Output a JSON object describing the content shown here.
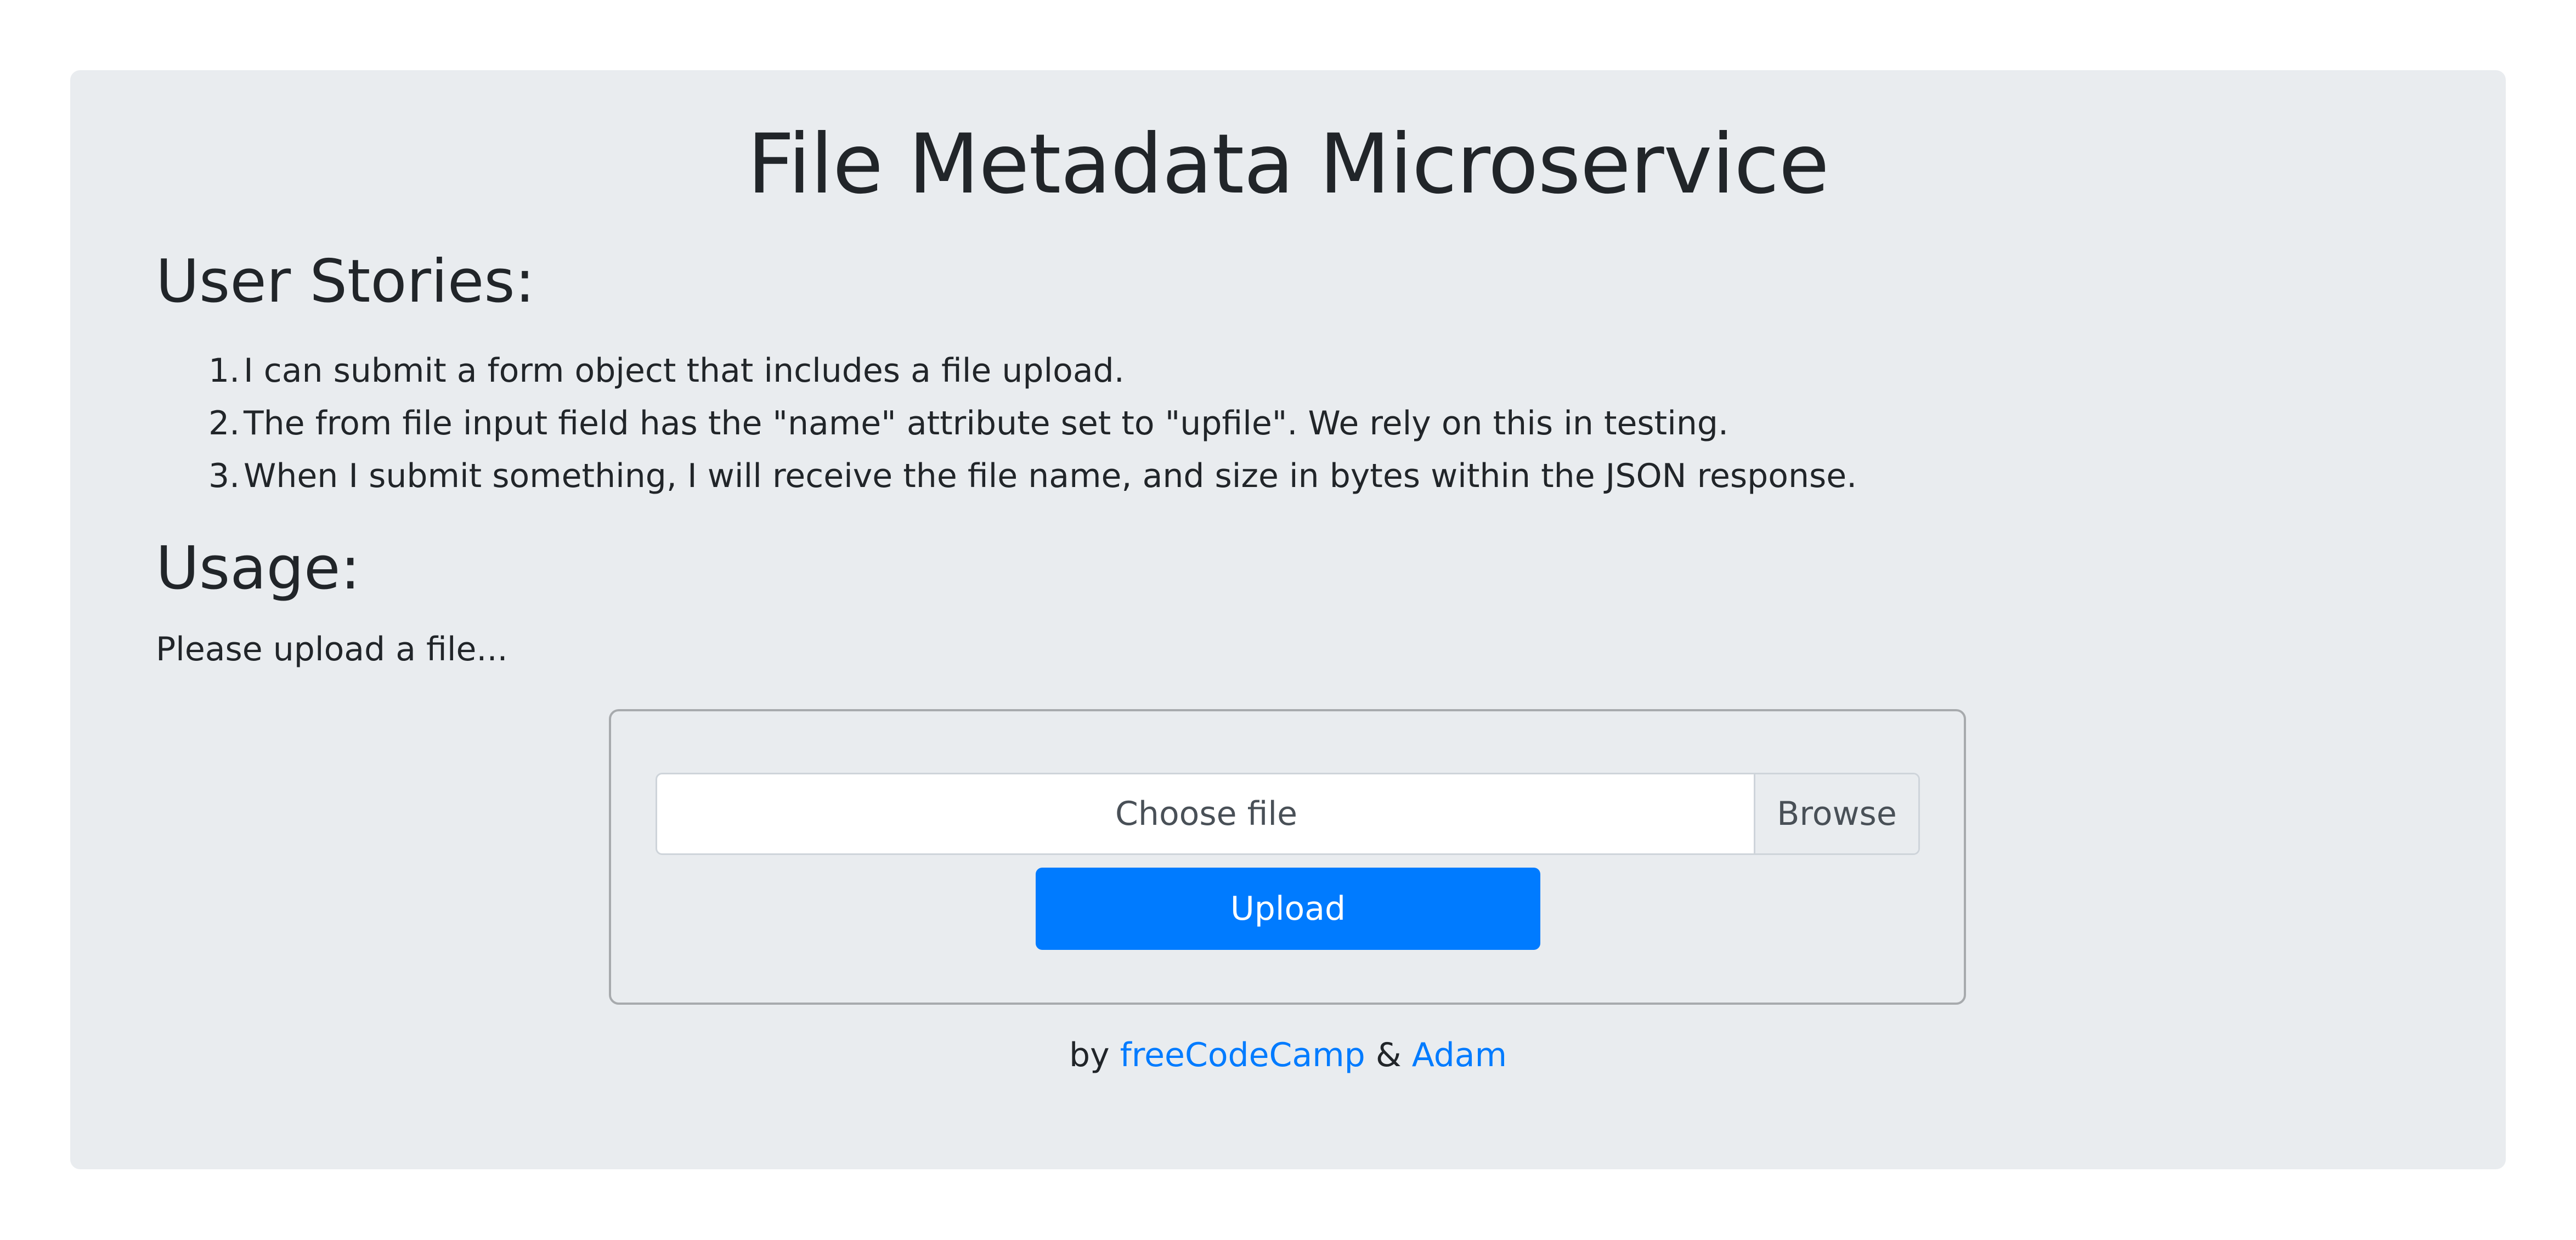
{
  "page": {
    "title": "File Metadata Microservice"
  },
  "stories": {
    "heading": "User Stories:",
    "items": [
      {
        "num": "1.",
        "text": "I can submit a form object that includes a file upload."
      },
      {
        "num": "2.",
        "text": "The from file input field has the \"name\" attribute set to \"upfile\". We rely on this in testing."
      },
      {
        "num": "3.",
        "text": "When I submit something, I will receive the file name, and size in bytes within the JSON response."
      }
    ]
  },
  "usage": {
    "heading": "Usage:",
    "text": "Please upload a file..."
  },
  "form": {
    "file_placeholder": "Choose file",
    "browse_label": "Browse",
    "upload_label": "Upload"
  },
  "credits": {
    "prefix": "by",
    "link1": "freeCodeCamp",
    "separator": "&",
    "link2": "Adam"
  },
  "colors": {
    "background": "#e9ecef",
    "primary": "#007bff",
    "text": "#212529"
  }
}
